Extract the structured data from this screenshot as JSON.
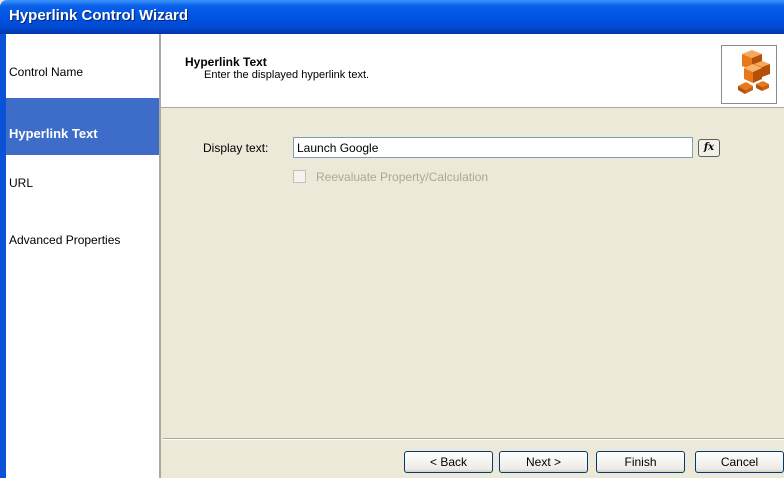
{
  "window": {
    "title": "Hyperlink Control Wizard"
  },
  "sidebar": {
    "items": [
      {
        "label": "Control Name",
        "selected": false
      },
      {
        "label": "Hyperlink Text",
        "selected": true
      },
      {
        "label": "URL",
        "selected": false
      },
      {
        "label": "Advanced Properties",
        "selected": false
      }
    ]
  },
  "header": {
    "title": "Hyperlink Text",
    "subtitle": "Enter the displayed hyperlink text.",
    "icon": "orange-cubes-icon"
  },
  "form": {
    "display_text_label": "Display text:",
    "display_text_value": "Launch Google",
    "fx_button": "fx",
    "reevaluate_label": "Reevaluate Property/Calculation",
    "reevaluate_checked": false,
    "reevaluate_enabled": false
  },
  "buttons": {
    "back": "< Back",
    "next": "Next >",
    "finish": "Finish",
    "cancel": "Cancel"
  },
  "colors": {
    "title_bar": "#0054E3",
    "sidebar_selected": "#3D6DC8",
    "dialog_background": "#ECE9D8",
    "icon_accent": "#E8781A"
  }
}
